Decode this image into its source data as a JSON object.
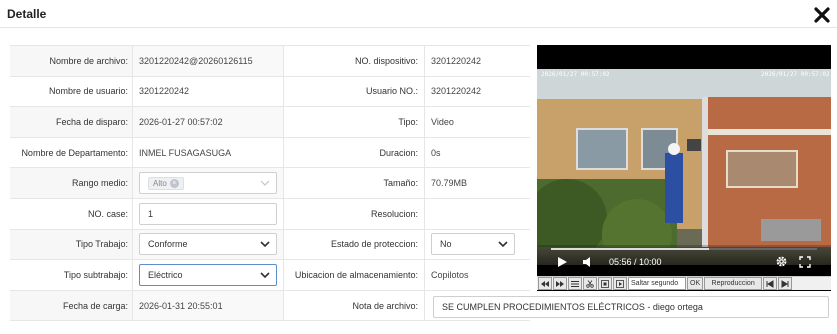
{
  "dialog": {
    "title": "Detalle"
  },
  "fields": {
    "nombre_archivo_label": "Nombre de archivo:",
    "nombre_archivo_value": "3201220242@20260126115",
    "nombre_usuario_label": "Nombre de usuario:",
    "nombre_usuario_value": "3201220242",
    "fecha_disparo_label": "Fecha de disparo:",
    "fecha_disparo_value": "2026-01-27 00:57:02",
    "departamento_label": "Nombre de Departamento:",
    "departamento_value": "INMEL FUSAGASUGA",
    "rango_medio_label": "Rango medio:",
    "rango_medio_tag": "Alto",
    "no_case_label": "NO. case:",
    "no_case_value": "1",
    "tipo_trabajo_label": "Tipo Trabajo:",
    "tipo_trabajo_value": "Conforme",
    "tipo_subtrabajo_label": "Tipo subtrabajo:",
    "tipo_subtrabajo_value": "Eléctrico",
    "fecha_carga_label": "Fecha de carga:",
    "fecha_carga_value": "2026-01-31 20:55:01",
    "no_dispositivo_label": "NO. dispositivo:",
    "no_dispositivo_value": "3201220242",
    "usuario_no_label": "Usuario NO.:",
    "usuario_no_value": "3201220242",
    "tipo_label": "Tipo:",
    "tipo_value": "Video",
    "duracion_label": "Duracion:",
    "duracion_value": "0s",
    "tamano_label": "Tamaño:",
    "tamano_value": "70.79MB",
    "resolucion_label": "Resolucion:",
    "resolucion_value": "",
    "estado_proteccion_label": "Estado de proteccion:",
    "estado_proteccion_value": "No",
    "ubicacion_label": "Ubicacion de almacenamiento:",
    "ubicacion_value": "Copilotos",
    "nota_label": "Nota de archivo:",
    "nota_value": "SE CUMPLEN PROCEDIMIENTOS ELÉCTRICOS - diego ortega"
  },
  "video": {
    "timestamp_left": "2026/01/27 00:57:02",
    "timestamp_right": "2026/01/27 00:57:02",
    "current_time": "05:56 / 10:00",
    "progress": 0.593
  },
  "toolbar": {
    "skip_input": "Saltar segundo",
    "ok_label": "OK",
    "reproduccion_label": "Reproduccion"
  },
  "colors": {
    "accent_border": "#5b8fc9",
    "video_bg": "#000000"
  }
}
